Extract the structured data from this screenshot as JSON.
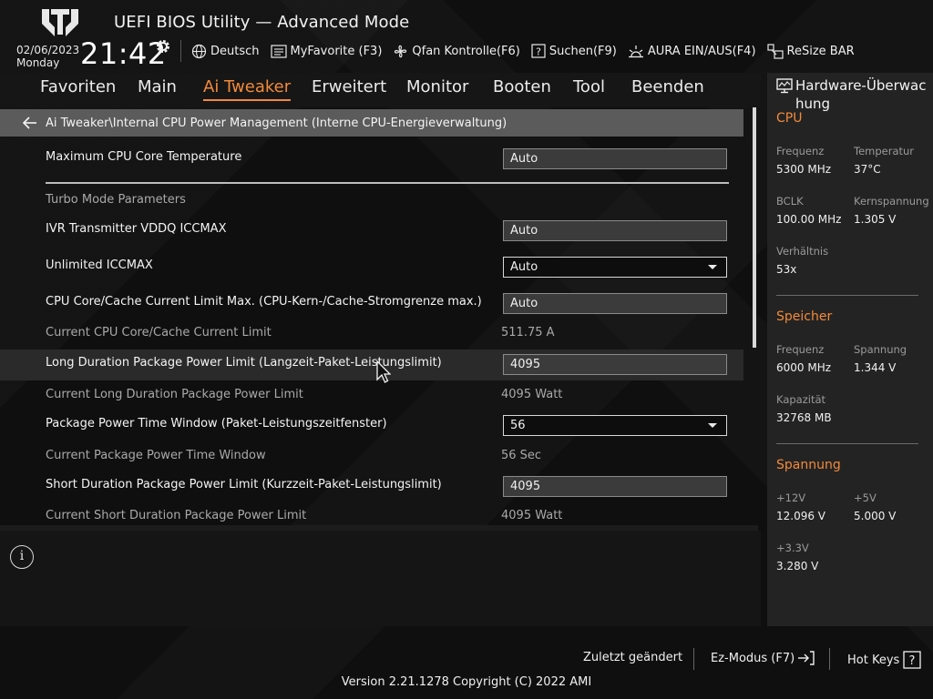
{
  "app": {
    "title": "UEFI BIOS Utility — Advanced Mode"
  },
  "datetime": {
    "date": "02/06/2023",
    "weekday": "Monday",
    "time": "21:42"
  },
  "toolbar": [
    {
      "label": "Deutsch",
      "icon": "globe-icon"
    },
    {
      "label": "MyFavorite (F3)",
      "icon": "favorite-list-icon"
    },
    {
      "label": "Qfan Kontrolle(F6)",
      "icon": "fan-icon"
    },
    {
      "label": "Suchen(F9)",
      "icon": "search-question-icon"
    },
    {
      "label": "AURA EIN/AUS(F4)",
      "icon": "aura-light-icon"
    },
    {
      "label": "ReSize BAR",
      "icon": "resize-bar-icon"
    }
  ],
  "nav": {
    "tabs": [
      "Favoriten",
      "Main",
      "Ai Tweaker",
      "Erweitert",
      "Monitor",
      "Booten",
      "Tool",
      "Beenden"
    ],
    "active": "Ai Tweaker"
  },
  "breadcrumb": "Ai Tweaker\\Internal CPU Power Management (Interne CPU-Energieverwaltung)",
  "settings": {
    "max_temp": {
      "label": "Maximum CPU Core Temperature",
      "value": "Auto"
    },
    "turbo_header": "Turbo Mode Parameters",
    "ivr": {
      "label": "IVR Transmitter VDDQ ICCMAX",
      "value": "Auto"
    },
    "unlimited": {
      "label": "Unlimited ICCMAX",
      "value": "Auto"
    },
    "core_cache": {
      "label": "CPU Core/Cache Current Limit Max. (CPU-Kern-/Cache-Stromgrenze max.)",
      "value": "Auto"
    },
    "current_core_cache": {
      "label": "Current CPU Core/Cache Current Limit",
      "value": "511.75 A"
    },
    "long_duration": {
      "label": "Long Duration Package Power Limit (Langzeit-Paket-Leistungslimit)",
      "value": "4095"
    },
    "current_long": {
      "label": "Current Long Duration Package Power Limit",
      "value": "4095 Watt"
    },
    "time_window": {
      "label": "Package Power Time Window (Paket-Leistungszeitfenster)",
      "value": "56"
    },
    "current_time_window": {
      "label": "Current Package Power Time Window",
      "value": "56 Sec"
    },
    "short_duration": {
      "label": "Short Duration Package Power Limit (Kurzzeit-Paket-Leistungslimit)",
      "value": "4095"
    },
    "current_short": {
      "label": "Current Short Duration Package Power Limit",
      "value": "4095 Watt"
    }
  },
  "hw_monitor": {
    "title": "Hardware-Überwachung",
    "title_line1": "Hardware-Überwac",
    "title_line2": "hung",
    "cpu": {
      "heading": "CPU",
      "freq_label": "Frequenz",
      "freq": "5300 MHz",
      "temp_label": "Temperatur",
      "temp": "37°C",
      "bclk_label": "BCLK",
      "bclk": "100.00 MHz",
      "vcore_label": "Kernspannung",
      "vcore": "1.305 V",
      "ratio_label": "Verhältnis",
      "ratio": "53x"
    },
    "memory": {
      "heading": "Speicher",
      "freq_label": "Frequenz",
      "freq": "6000 MHz",
      "volt_label": "Spannung",
      "volt": "1.344 V",
      "cap_label": "Kapazität",
      "cap": "32768 MB"
    },
    "voltage": {
      "heading": "Spannung",
      "v12_label": "+12V",
      "v12": "12.096 V",
      "v5_label": "+5V",
      "v5": "5.000 V",
      "v33_label": "+3.3V",
      "v33": "3.280 V"
    }
  },
  "footer": {
    "last_changed": "Zuletzt geändert",
    "ez_mode": "Ez-Modus (F7)",
    "hot_keys": "Hot Keys",
    "version": "Version 2.21.1278 Copyright (C) 2022 AMI"
  },
  "colors": {
    "accent": "#f28a3a",
    "highlight_row": "#2a2a2a",
    "breadcrumb_bg": "#5b5b5b"
  }
}
